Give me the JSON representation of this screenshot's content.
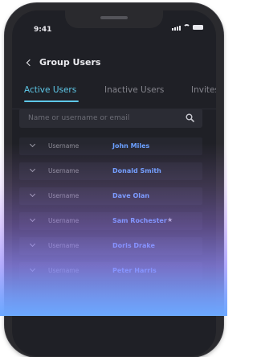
{
  "status_bar": {
    "time": "9:41"
  },
  "header": {
    "title": "Group Users"
  },
  "tabs": [
    {
      "label": "Active Users"
    },
    {
      "label": "Inactive Users"
    },
    {
      "label": "Invites"
    }
  ],
  "search": {
    "placeholder": "Name or username or email"
  },
  "users": [
    {
      "label": "Username",
      "value": "John Miles"
    },
    {
      "label": "Username",
      "value": "Donald Smith"
    },
    {
      "label": "Username",
      "value": "Dave Olan"
    },
    {
      "label": "Username",
      "value": "Sam Rochester"
    },
    {
      "label": "Username",
      "value": "Doris Drake"
    },
    {
      "label": "Username",
      "value": "Peter Harris"
    }
  ],
  "colors": {
    "accent": "#5ec8e8",
    "link": "#6aa0ff",
    "background": "#1f2026"
  },
  "icons": [
    "back-chevron-icon",
    "search-icon",
    "chevron-down-icon",
    "star-icon",
    "signal-icon",
    "wifi-icon",
    "battery-icon"
  ]
}
